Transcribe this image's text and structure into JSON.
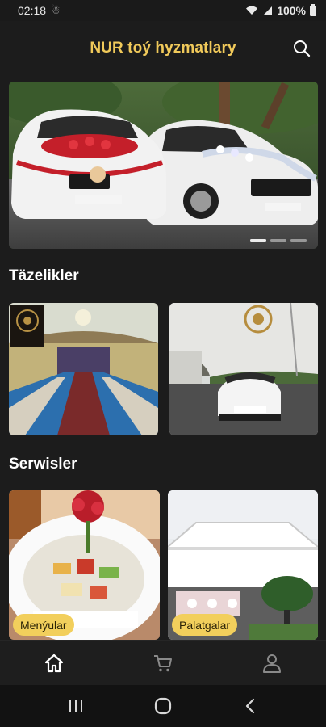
{
  "status_bar": {
    "time": "02:18",
    "notification_glyph": "☃",
    "battery": "100%"
  },
  "app_bar": {
    "title": "NUR toý hyzmatlary",
    "search_icon": "search-icon"
  },
  "hero": {
    "slide_count": 3,
    "active_slide": 1
  },
  "sections": {
    "news_title": "Täzelikler",
    "services_title": "Serwisler"
  },
  "services": [
    {
      "label": "Menýular"
    },
    {
      "label": "Palatgalar"
    }
  ],
  "bottom_nav": {
    "items": [
      "home-icon",
      "cart-icon",
      "profile-icon"
    ],
    "active": "home-icon"
  },
  "colors": {
    "accent": "#f0c95a",
    "badge": "#f2cf5c",
    "background": "#1c1c1c"
  }
}
